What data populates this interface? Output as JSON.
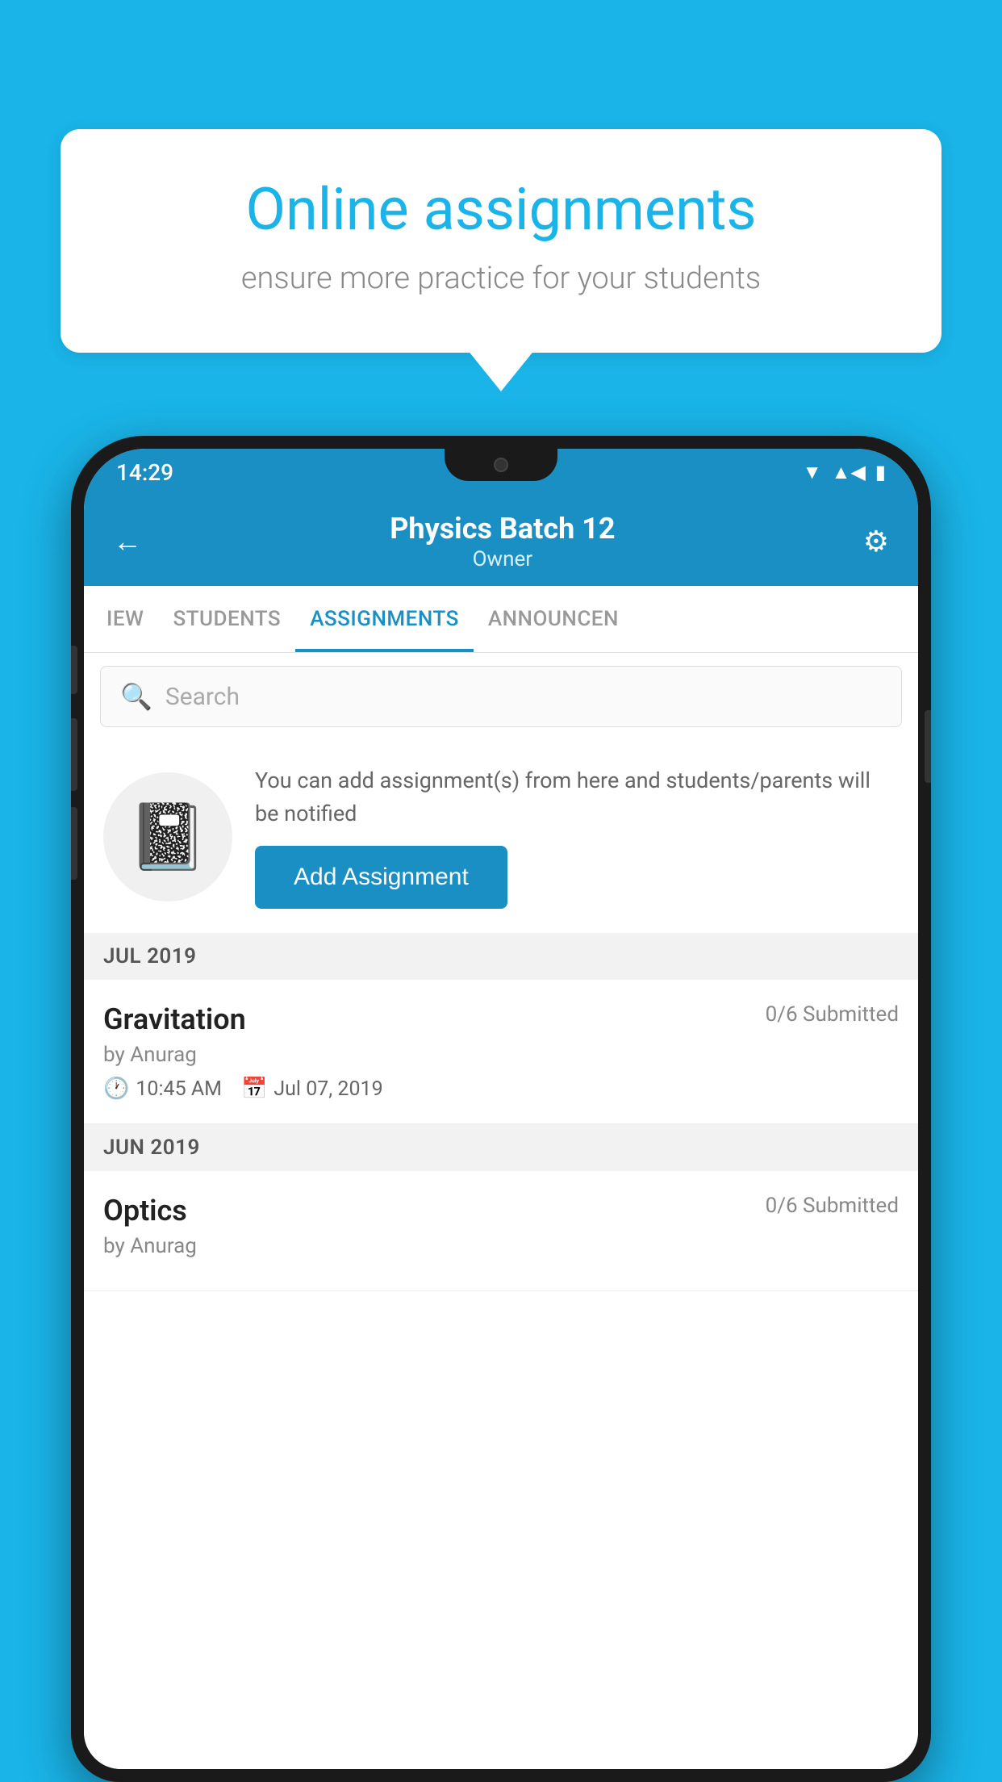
{
  "background_color": "#1ab4e8",
  "speech_bubble": {
    "title": "Online assignments",
    "subtitle": "ensure more practice for your students"
  },
  "status_bar": {
    "time": "14:29",
    "icons": [
      "wifi",
      "signal",
      "battery"
    ]
  },
  "app_header": {
    "title": "Physics Batch 12",
    "subtitle": "Owner",
    "back_label": "←",
    "settings_label": "⚙"
  },
  "tabs": [
    {
      "label": "IEW",
      "active": false
    },
    {
      "label": "STUDENTS",
      "active": false
    },
    {
      "label": "ASSIGNMENTS",
      "active": true
    },
    {
      "label": "ANNOUNCEN",
      "active": false
    }
  ],
  "search": {
    "placeholder": "Search"
  },
  "add_assignment": {
    "description": "You can add assignment(s) from here and students/parents will be notified",
    "button_label": "Add Assignment"
  },
  "sections": [
    {
      "label": "JUL 2019",
      "items": [
        {
          "name": "Gravitation",
          "submitted": "0/6 Submitted",
          "author": "by Anurag",
          "time": "10:45 AM",
          "date": "Jul 07, 2019"
        }
      ]
    },
    {
      "label": "JUN 2019",
      "items": [
        {
          "name": "Optics",
          "submitted": "0/6 Submitted",
          "author": "by Anurag",
          "time": "",
          "date": ""
        }
      ]
    }
  ]
}
